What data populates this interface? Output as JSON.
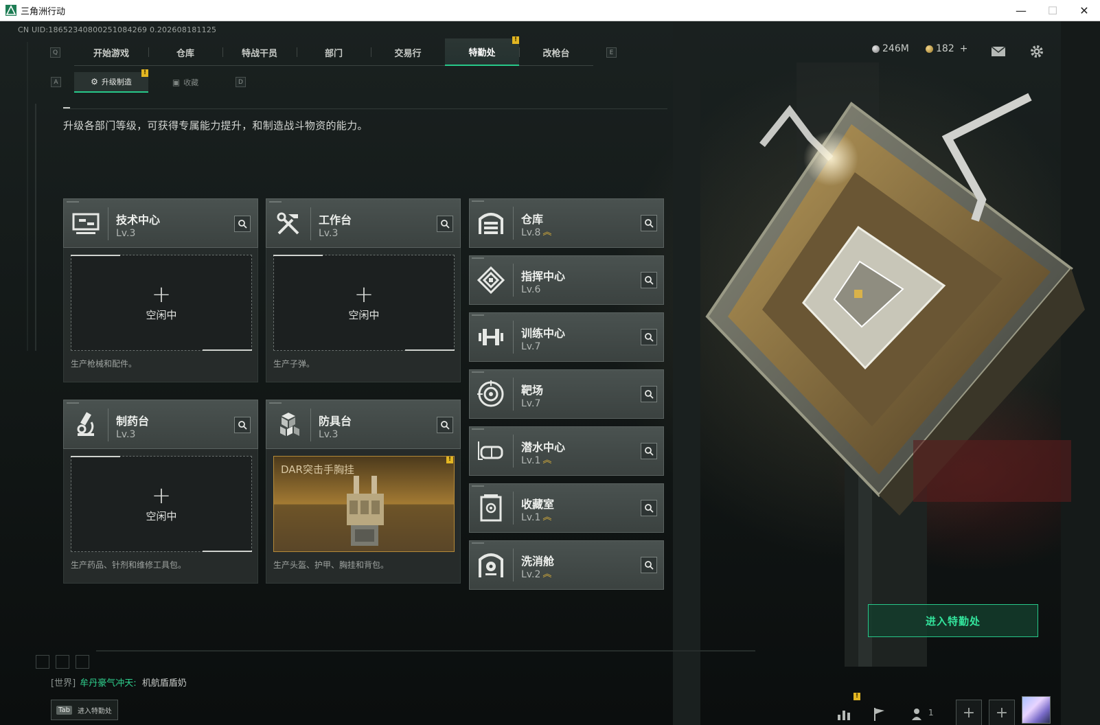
{
  "window": {
    "title": "三角洲行动",
    "minimize": "—",
    "maximize": "☐",
    "close": "✕"
  },
  "uid": "CN UID:18652340800251084269 0.202608181125",
  "nav": {
    "prev_key": "Q",
    "next_key": "E",
    "items": [
      {
        "label": "开始游戏"
      },
      {
        "label": "仓库"
      },
      {
        "label": "特战干员"
      },
      {
        "label": "部门"
      },
      {
        "label": "交易行"
      },
      {
        "label": "特勤处",
        "active": true,
        "badge": "!"
      },
      {
        "label": "改枪台"
      }
    ]
  },
  "resources": {
    "money": "246M",
    "coins": "182",
    "coins_add": "+"
  },
  "subtabs": {
    "prev_key": "A",
    "next_key": "D",
    "items": [
      {
        "label": "升级制造",
        "active": true,
        "badge": "!"
      },
      {
        "label": "收藏"
      }
    ]
  },
  "description": "升级各部门等级，可获得专属能力提升，和制造战斗物资的能力。",
  "production_depts": [
    {
      "name": "技术中心",
      "level": "Lv.3",
      "icon": "monitor-icon",
      "slot_plus": "+",
      "slot_status": "空闲中",
      "desc": "生产枪械和配件。"
    },
    {
      "name": "工作台",
      "level": "Lv.3",
      "icon": "tools-icon",
      "slot_plus": "+",
      "slot_status": "空闲中",
      "desc": "生产子弹。"
    },
    {
      "name": "制药台",
      "level": "Lv.3",
      "icon": "microscope-icon",
      "slot_plus": "+",
      "slot_status": "空闲中",
      "desc": "生产药品、针剂和维修工具包。"
    },
    {
      "name": "防具台",
      "level": "Lv.3",
      "icon": "boxes-icon",
      "slot_item": "DAR突击手胸挂",
      "slot_badge": "!",
      "desc": "生产头盔、护甲、胸挂和背包。"
    }
  ],
  "other_depts": [
    {
      "name": "仓库",
      "level": "Lv.8",
      "icon": "garage-icon",
      "upgradeable": true,
      "up_mark": "︽"
    },
    {
      "name": "指挥中心",
      "level": "Lv.6",
      "icon": "command-icon"
    },
    {
      "name": "训练中心",
      "level": "Lv.7",
      "icon": "dumbbell-icon"
    },
    {
      "name": "靶场",
      "level": "Lv.7",
      "icon": "target-icon"
    },
    {
      "name": "潜水中心",
      "level": "Lv.1",
      "icon": "goggles-icon",
      "upgradeable": true,
      "up_mark": "︽"
    },
    {
      "name": "收藏室",
      "level": "Lv.1",
      "icon": "vault-icon",
      "upgradeable": true,
      "up_mark": "︽"
    },
    {
      "name": "洗消舱",
      "level": "Lv.2",
      "icon": "hazmat-icon",
      "upgradeable": true,
      "up_mark": "︽"
    }
  ],
  "enter_button": "进入特勤处",
  "chat": {
    "channel": "[世界]",
    "user": "牟丹豪气冲天:",
    "message": "机航盾盾奶"
  },
  "tab_hint": {
    "key": "Tab",
    "label": "进入特勤处"
  },
  "bottom": {
    "stats_badge": "!",
    "friends_count": "1",
    "plus": "+"
  },
  "colors": {
    "accent_green": "#27c98a",
    "badge_yellow": "#e3b622",
    "upgrade_gold": "#e0b43a"
  }
}
